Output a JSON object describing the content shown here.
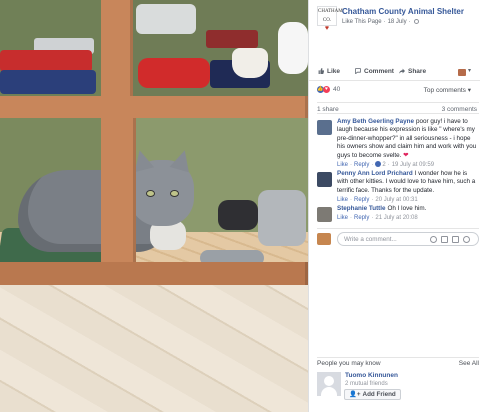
{
  "page": {
    "name": "Chatham County Animal Shelter",
    "avatar_text": "CHATHAM CO.",
    "avatar_heart": "♥",
    "like_this_page": "Like This Page",
    "date": "18 July"
  },
  "actions": {
    "like": "Like",
    "comment": "Comment",
    "share": "Share"
  },
  "reactions": {
    "count": "40",
    "top_comments": "Top comments ▾"
  },
  "counts": {
    "shares": "1 share",
    "comments": "3 comments"
  },
  "comments": [
    {
      "author": "Amy Beth Geerling Payne",
      "text": "poor guy! i have to laugh because his expression is like \" where's my pre-dinner-whopper?\" in all seriousness - i hope his owners show and claim him and work with you guys to become svelte.",
      "emoji": "❤",
      "like": "Like",
      "reply": "Reply",
      "reaction_count": "2",
      "time": "19 July at 09:59",
      "avatar_color": "#5a6f8e"
    },
    {
      "author": "Penny Ann Lord Prichard",
      "text": "I wonder how he is with other kitties. I would love to have him, such a terrific face. Thanks for the update.",
      "like": "Like",
      "reply": "Reply",
      "time": "20 July at 00:31",
      "avatar_color": "#3c4a63"
    },
    {
      "author": "Stephanie Tuttle",
      "text": "Oh I love him.",
      "like": "Like",
      "reply": "Reply",
      "time": "21 July at 20:08",
      "avatar_color": "#7d7a74"
    }
  ],
  "write_comment": {
    "placeholder": "Write a comment..."
  },
  "pymk": {
    "title": "People you may know",
    "see_all": "See All",
    "name": "Tuomo Kinnunen",
    "mutual": "2 mutual friends",
    "add_friend": "Add Friend"
  },
  "colors": {
    "link": "#365899",
    "fb_blue": "#4267b2",
    "love": "#f33e58"
  }
}
